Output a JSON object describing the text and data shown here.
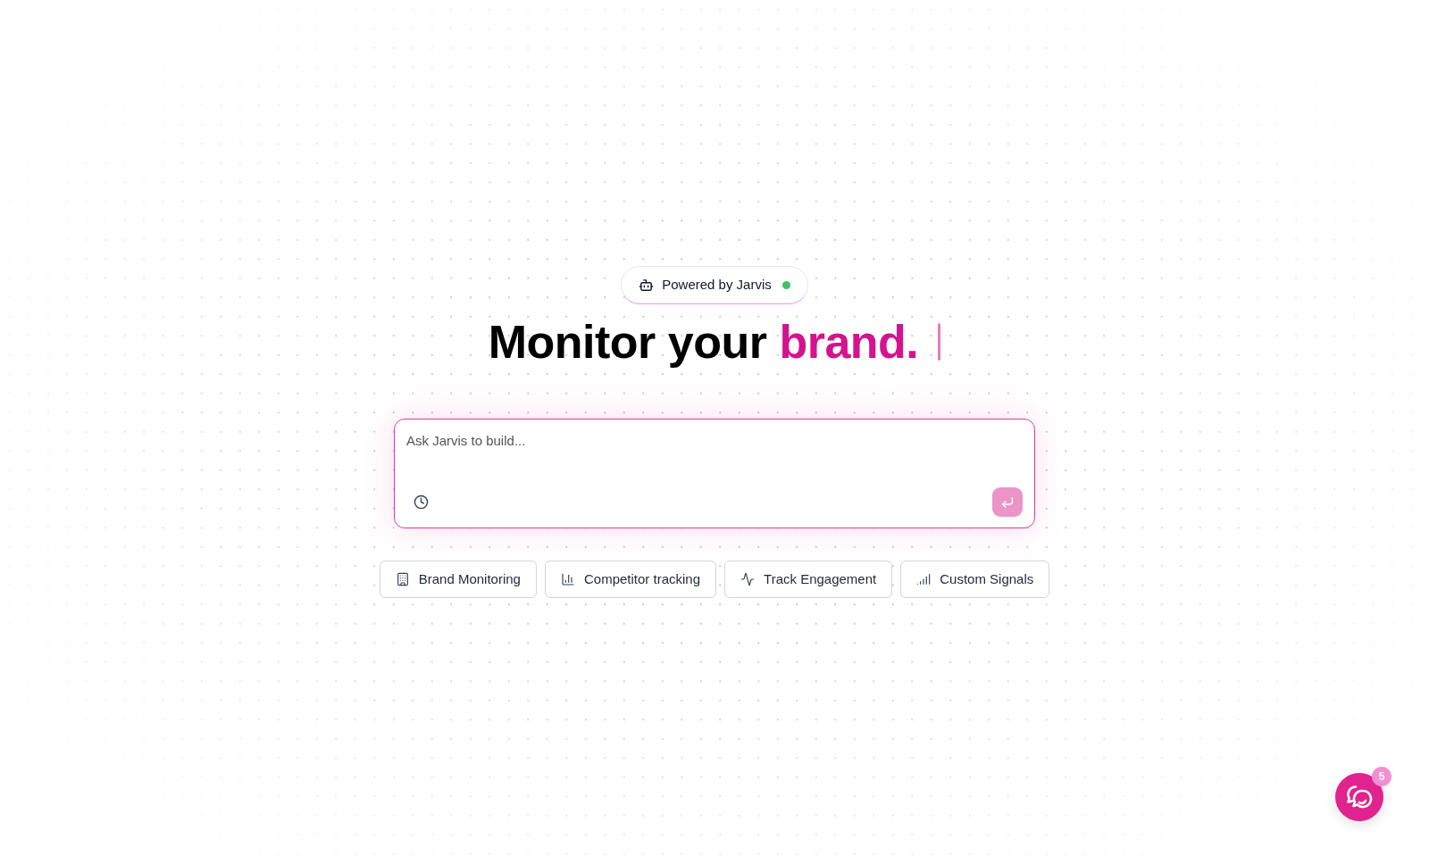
{
  "badge": {
    "label": "Powered by Jarvis",
    "online": true
  },
  "headline": {
    "text": "Monitor your",
    "accent": "brand."
  },
  "prompt": {
    "placeholder": "Ask Jarvis to build...",
    "send_disabled": true
  },
  "suggestions": [
    {
      "label": "Brand Monitoring"
    },
    {
      "label": "Competitor tracking"
    },
    {
      "label": "Track Engagement"
    },
    {
      "label": "Custom Signals"
    }
  ],
  "chat_launcher": {
    "unread": "5"
  }
}
